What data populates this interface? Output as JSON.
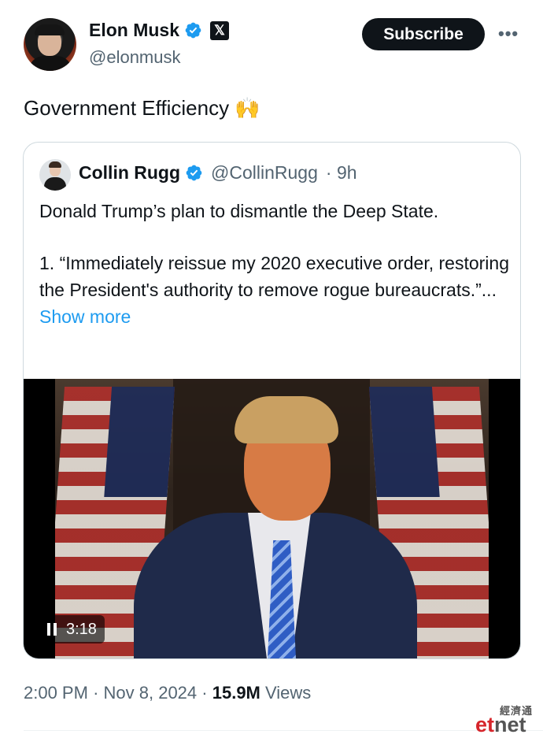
{
  "author": {
    "name": "Elon Musk",
    "handle": "@elonmusk",
    "subscribe_label": "Subscribe",
    "more_label": "•••"
  },
  "tweet": {
    "text": "Government Efficiency 🙌",
    "time": "2:00 PM",
    "date": "Nov 8, 2024",
    "separator": "·",
    "views_count": "15.9M",
    "views_label": "Views"
  },
  "quote": {
    "name": "Collin Rugg",
    "handle": "@CollinRugg",
    "age": "· 9h",
    "text_line1": "Donald Trump’s plan to dismantle the Deep State.",
    "text_line2": "1. “Immediately reissue my 2020 executive order, restoring the President's authority to remove rogue bureaucrats.”...",
    "show_more": "Show more",
    "video_duration": "3:18"
  },
  "watermark": {
    "chinese": "經濟通",
    "brand_e": "et",
    "brand_rest": "net"
  },
  "colors": {
    "verified": "#1d9bf0",
    "link": "#1d9bf0",
    "secondary_text": "#536471"
  }
}
